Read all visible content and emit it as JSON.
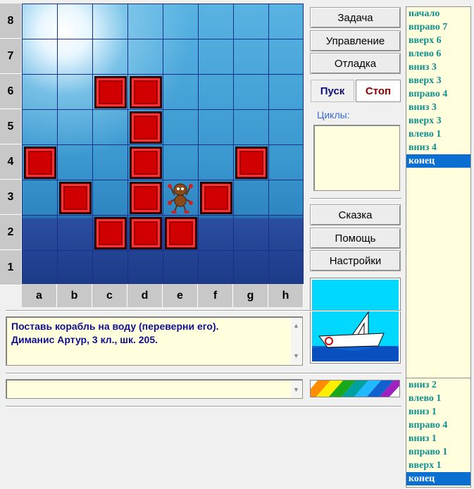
{
  "board": {
    "rows": [
      "8",
      "7",
      "6",
      "5",
      "4",
      "3",
      "2",
      "1"
    ],
    "columns": [
      "a",
      "b",
      "c",
      "d",
      "e",
      "f",
      "g",
      "h"
    ],
    "blocks": [
      "c6",
      "d6",
      "d5",
      "a4",
      "d4",
      "g4",
      "b3",
      "d3",
      "f3",
      "c2",
      "d2",
      "e2"
    ],
    "robot": "e3"
  },
  "buttons": {
    "task": "Задача",
    "control": "Управление",
    "debug": "Отладка",
    "start": "Пуск",
    "stop": "Стоп",
    "tale": "Сказка",
    "help": "Помощь",
    "settings": "Настройки"
  },
  "cycles_label": "Циклы:",
  "description": {
    "line1": "Поставь корабль на воду (переверни его).",
    "line2": "Диманис  Артур, 3 кл., шк. 205."
  },
  "command_input": "",
  "program_top": [
    "начало",
    "вправо 7",
    "вверх 6",
    "влево 6",
    "вниз 3",
    "вверх 3",
    "вправо 4",
    "вниз 3",
    "вверх 3",
    "влево 1",
    "вниз 4",
    "конец"
  ],
  "program_top_selected": "конец",
  "program_bottom": [
    "вниз 2",
    "влево 1",
    "вниз 1",
    "вправо 4",
    "вниз 1",
    "вправо 1",
    "вверх 1",
    "конец"
  ],
  "program_bottom_selected": "конец",
  "colors": {
    "block_red": "#d00000",
    "program_text": "#10908c",
    "selection": "#0a6fd0",
    "panel_bg": "#fffedd",
    "stop_text": "#8b0000",
    "start_text": "#10107a"
  },
  "icons": [
    "robot-icon",
    "boat-icon",
    "rainbow-palette-icon",
    "scroll-up-icon",
    "scroll-down-icon"
  ]
}
